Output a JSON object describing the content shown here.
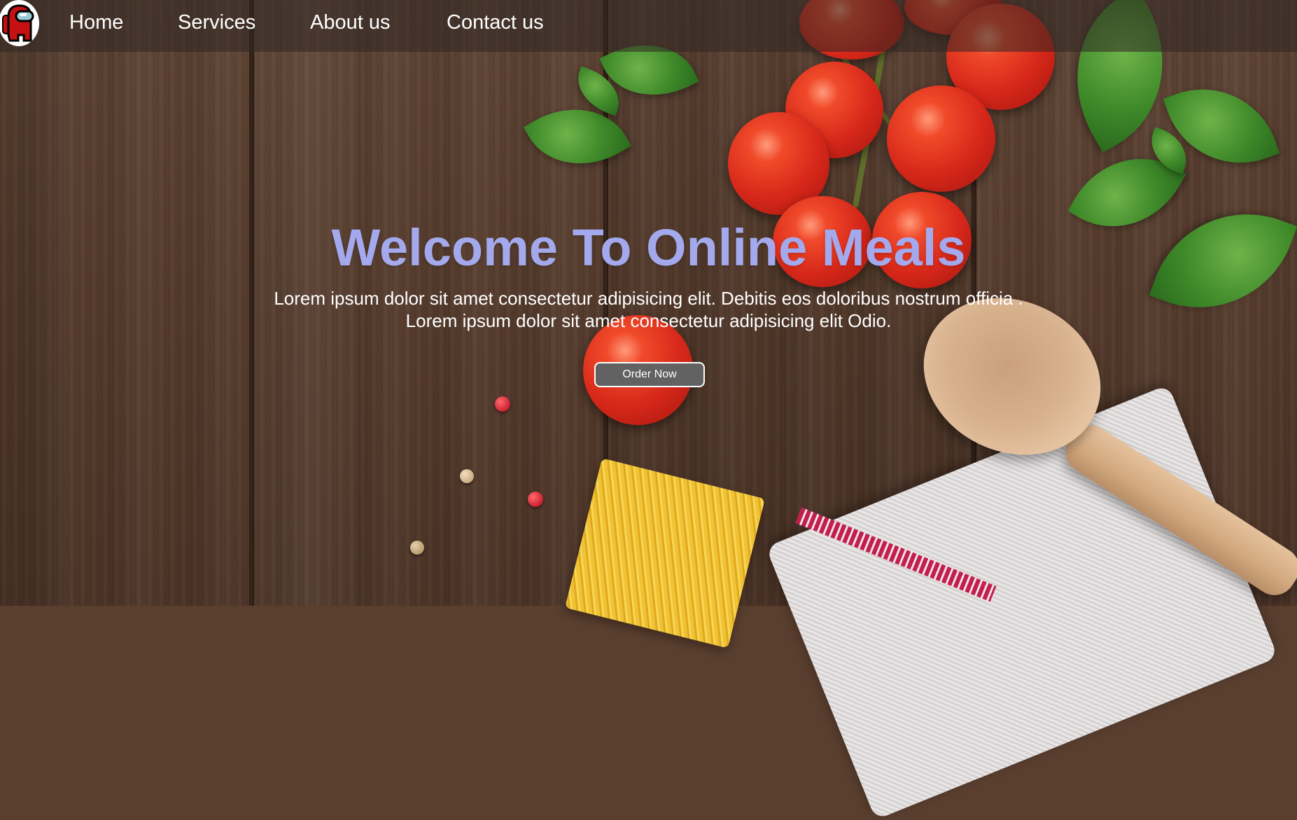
{
  "navbar": {
    "logo_icon": "crewmate-icon",
    "links": [
      {
        "label": "Home"
      },
      {
        "label": "Services"
      },
      {
        "label": "About us"
      },
      {
        "label": "Contact us"
      }
    ]
  },
  "hero": {
    "title": "Welcome To Online Meals",
    "text_line1": "Lorem ipsum dolor sit amet consectetur adipisicing elit. Debitis eos doloribus nostrum officia .",
    "text_line2": "Lorem ipsum dolor sit amet consectetur adipisicing elit Odio.",
    "button_label": "Order Now"
  },
  "colors": {
    "title": "#a3a9ec",
    "nav_text": "#ffffff",
    "button_bg": "#626262"
  }
}
